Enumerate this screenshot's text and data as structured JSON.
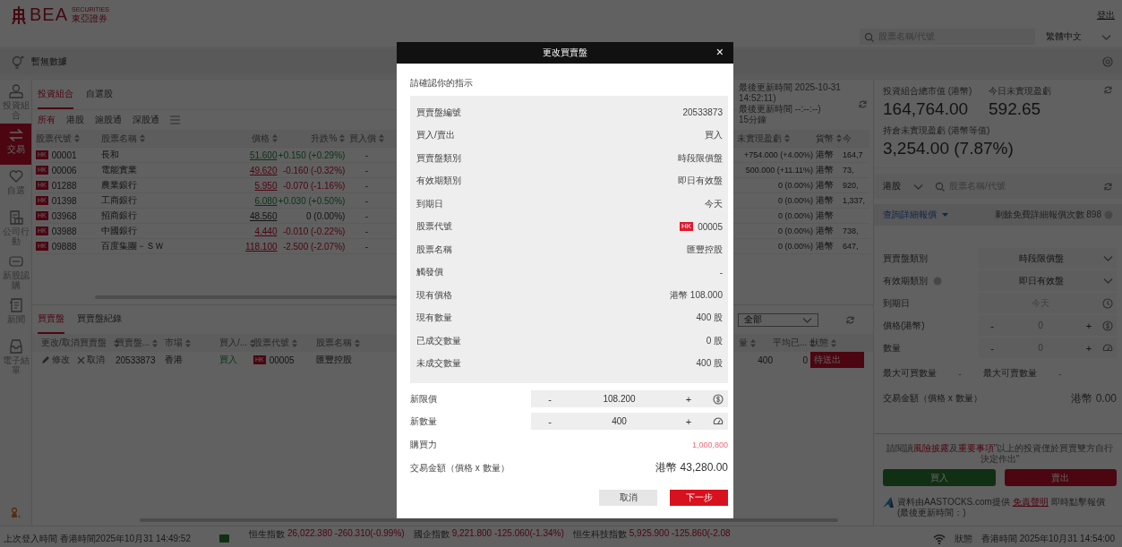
{
  "header": {
    "logo": "BEA",
    "logo_tagline": "SECURITIES",
    "logo_tagline_zh": "東亞證券",
    "logout": "登出",
    "search": {
      "placeholder": "股票名稱/代號"
    },
    "language": "繁體中文"
  },
  "notice": {
    "text": "暫無數據"
  },
  "nav_rail": {
    "items": [
      {
        "kind": "person",
        "label": "投資組合",
        "selected": false
      },
      {
        "kind": "swap",
        "label": "交易",
        "selected": true
      },
      {
        "kind": "heart",
        "label": "自選",
        "selected": false
      },
      {
        "kind": "doc",
        "label": "公司行動",
        "selected": false
      },
      {
        "kind": "ipo",
        "label": "新股認購",
        "selected": false
      },
      {
        "kind": "news",
        "label": "新聞",
        "selected": false
      },
      {
        "kind": "inbox",
        "label": "電子結單",
        "selected": false
      }
    ]
  },
  "holdings": {
    "tabs": [
      {
        "label": "投資組合",
        "selected": true
      },
      {
        "label": "自選股",
        "selected": false
      }
    ],
    "markets": [
      {
        "label": "所有",
        "selected": true
      },
      {
        "label": "港股",
        "selected": false
      },
      {
        "label": "滬股通",
        "selected": false
      },
      {
        "label": "深股通",
        "selected": false
      }
    ],
    "update_info": [
      "最後更新時間 2025-10-31 14:52:11)",
      "最後更新時間 --:--:--)",
      "15分鐘"
    ],
    "columns_left": [
      "股票代號",
      "股票名稱",
      "價格",
      "升跌%",
      "買入價"
    ],
    "columns_right": [
      "未實現盈虧",
      "貨幣",
      "今"
    ],
    "rows": [
      {
        "badge": "HK",
        "code": "00001",
        "name": "長和",
        "price": "51.600",
        "kind": "up",
        "change": "+0.150 (+0.29%)",
        "bid": "-",
        "pnl": "+754.000 (+4.00%)",
        "currency": "港幣",
        "today": "164,7"
      },
      {
        "badge": "HK",
        "code": "00006",
        "name": "電能實業",
        "price": "49.620",
        "kind": "down",
        "change": "-0.160 (-0.32%)",
        "bid": "-",
        "pnl": "500.000 (+11.11%)",
        "currency": "港幣",
        "today": "73,"
      },
      {
        "badge": "HK",
        "code": "01288",
        "name": "農業銀行",
        "price": "5.950",
        "kind": "down",
        "change": "-0.070 (-1.16%)",
        "bid": "-",
        "pnl": "0 (0.00%)",
        "currency": "港幣",
        "today": "920,"
      },
      {
        "badge": "HK",
        "code": "01398",
        "name": "工商銀行",
        "price": "6.080",
        "kind": "up",
        "change": "+0.030 (+0.50%)",
        "bid": "-",
        "pnl": "0 (0.00%)",
        "currency": "港幣",
        "today": "1,337,"
      },
      {
        "badge": "HK",
        "code": "03968",
        "name": "招商銀行",
        "price": "48.560",
        "kind": "flat",
        "change": "0 (0.00%)",
        "bid": "-",
        "pnl": "0 (0.00%)",
        "currency": "港幣"
      },
      {
        "badge": "HK",
        "code": "03988",
        "name": "中國銀行",
        "price": "4.440",
        "kind": "down",
        "change": "-0.010 (-0.22%)",
        "bid": "-",
        "pnl": "0 (0.00%)",
        "currency": "港幣",
        "today": "738,"
      },
      {
        "badge": "HK",
        "code": "09888",
        "name": "百度集團－ＳＷ",
        "price": "118.100",
        "kind": "down",
        "change": "-2.500 (-2.07%)",
        "bid": "-",
        "pnl": "0 (0.00%)",
        "currency": "港幣",
        "today": "647,"
      }
    ]
  },
  "orders": {
    "tabs": [
      {
        "label": "買賣盤",
        "selected": true
      },
      {
        "label": "買賣盤紀錄",
        "selected": false
      }
    ],
    "filter": {
      "value": "全部"
    },
    "columns_left": [
      "更改/取消買賣盤",
      "買賣盤...",
      "市場",
      "買入/...",
      "股票代號",
      "股票名稱"
    ],
    "columns_right": [
      "量",
      "平均已...",
      "狀態"
    ],
    "rows": [
      {
        "kind": "buy",
        "modify": "修改",
        "cancel": "取消",
        "order_no": "20533873",
        "market": "香港",
        "side": "買入",
        "badge": "HK",
        "code": "00005",
        "name": "匯豐控股",
        "quantity": "400",
        "avg_price": "0",
        "status": "待送出"
      }
    ]
  },
  "summary": {
    "market_value_label": "投資組合總市值 (港幣)",
    "market_value": "164,764.00",
    "today_pnl_label": "今日未實現盈虧",
    "today_pnl": "592.65",
    "holding_pnl_label": "持倉未實現盈虧 (港幣等值)",
    "holding_pnl": "3,254.00 (7.87%)"
  },
  "quote": {
    "market": "港股",
    "search_placeholder": "股票名稱/代號",
    "detail_link": "查詢詳細報價",
    "remaining": "剩餘免費詳細報價次數 898"
  },
  "order_form": {
    "order_type_label": "買賣盤類別",
    "order_type": "時段限價盤",
    "validity_label": "有效期類別",
    "validity": "即日有效盤",
    "expiry_label": "到期日",
    "expiry": "今天",
    "price_label": "價格(港幣)",
    "price": "0",
    "quantity_label": "數量",
    "quantity": "0",
    "minus": "-",
    "plus": "+",
    "max_buy_label": "最大可買數量",
    "max_buy": "-",
    "max_sell_label": "最大可賣數量",
    "max_sell": "-",
    "amount_label": "交易金額（價格 x 數量）",
    "amount": "港幣 0.00",
    "note": "請閱讀**風險披露**及**重要事項**\"以上的投資僅於買賣雙方自行決定作出\"",
    "buy": "買入",
    "sell": "賣出",
    "source": "資料由AASTOCKS.com提供",
    "disclaimer": "免責聲明",
    "source_tail": "即時點擊報價",
    "updated": "(最後更新時間：)"
  },
  "status_bar": {
    "last_login": "上次登入時間 香港時間2025年10月31 14:49:52",
    "indices": [
      {
        "name": "恒生指數",
        "value": "26,022.380 -260.310(-0.99%)"
      },
      {
        "name": "國企指數",
        "value": "9,221.800 -125.060(-1.34%)"
      },
      {
        "name": "恒生科技指數",
        "value": "5,925.900 -125.860(-2.08"
      }
    ],
    "status": "狀態",
    "time": "香港時間 2025年10月31 14:54:00"
  },
  "dialog": {
    "title": "更改買賣盤",
    "close": "×",
    "prompt": "請確認你的指示",
    "rows": [
      {
        "kind": "text",
        "label": "買賣盤編號",
        "value": "20533873"
      },
      {
        "kind": "buy",
        "label": "買入/賣出",
        "value": "買入"
      },
      {
        "kind": "text",
        "label": "買賣盤類別",
        "value": "時段限價盤"
      },
      {
        "kind": "text",
        "label": "有效期類別",
        "value": "即日有效盤"
      },
      {
        "kind": "text",
        "label": "到期日",
        "value": "今天"
      },
      {
        "kind": "stock",
        "label": "股票代號",
        "badge": "HK",
        "value": "00005"
      },
      {
        "kind": "text",
        "label": "股票名稱",
        "value": "匯豐控股"
      },
      {
        "kind": "text",
        "label": "觸發價",
        "value": "-"
      },
      {
        "kind": "text",
        "label": "現有價格",
        "value": "港幣 108.000"
      },
      {
        "kind": "text",
        "label": "現有數量",
        "value": "400 股"
      },
      {
        "kind": "text",
        "label": "已成交數量",
        "value": "0 股"
      },
      {
        "kind": "text",
        "label": "未成交數量",
        "value": "400 股"
      }
    ],
    "inputs": [
      {
        "kind": "price",
        "label": "新限價",
        "value": "108.200",
        "minus": "-",
        "plus": "+"
      },
      {
        "kind": "quantity",
        "label": "新數量",
        "value": "400",
        "minus": "-",
        "plus": "+"
      }
    ],
    "buying_power_label": "購買力",
    "buying_power": "1,000,800",
    "amount_label": "交易金額（價格 x 數量）",
    "amount": "港幣 43,280.00",
    "cancel": "取消",
    "next": "下一步"
  }
}
